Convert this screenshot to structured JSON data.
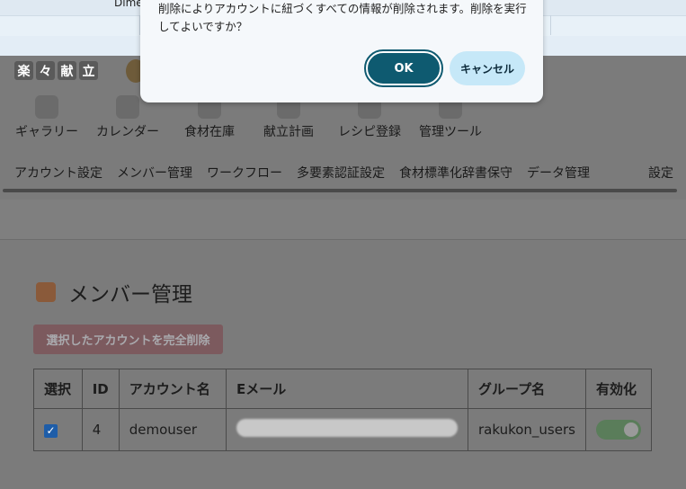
{
  "browser": {
    "partial_text": "Dime"
  },
  "logo": {
    "chars": [
      "楽",
      "々",
      "献",
      "立"
    ]
  },
  "nav": {
    "items": [
      {
        "label": "ギャラリー",
        "icon": "salad-icon"
      },
      {
        "label": "カレンダー",
        "icon": "calendar-icon"
      },
      {
        "label": "食材在庫",
        "icon": "fridge-icon"
      },
      {
        "label": "献立計画",
        "icon": "chef-icon"
      },
      {
        "label": "レシピ登録",
        "icon": "recipe-icon"
      },
      {
        "label": "管理ツール",
        "icon": "laptop-icon"
      }
    ]
  },
  "subnav": {
    "items": [
      "アカウント設定",
      "メンバー管理",
      "ワークフロー",
      "多要素認証設定",
      "食材標準化辞書保守",
      "データ管理"
    ],
    "settings": "設定"
  },
  "page": {
    "title": "メンバー管理",
    "delete_button": "選択したアカウントを完全削除"
  },
  "table": {
    "headers": [
      "選択",
      "ID",
      "アカウント名",
      "Eメール",
      "グループ名",
      "有効化"
    ],
    "rows": [
      {
        "selected": true,
        "id": "4",
        "account": "demouser",
        "email": "",
        "group": "rakukon_users",
        "enabled": true
      }
    ]
  },
  "dialog": {
    "message": "削除によりアカウントに紐づくすべての情報が削除されます。削除を実行してよいですか？",
    "ok": "OK",
    "cancel": "キャンセル"
  },
  "colors": {
    "ok_button": "#0e5a70",
    "cancel_button": "#c6e8f8",
    "checkbox": "#1e5da8"
  }
}
